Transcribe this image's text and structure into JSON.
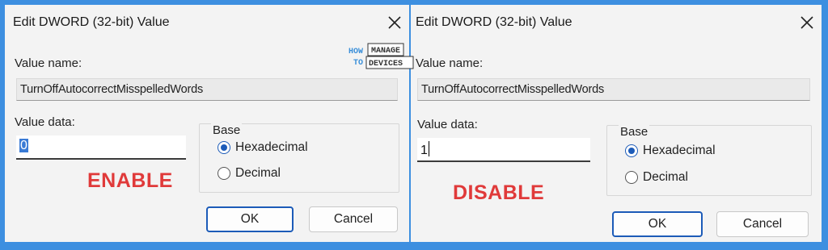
{
  "dialog_left": {
    "title": "Edit DWORD (32-bit) Value",
    "value_name_label": "Value name:",
    "value_name": "TurnOffAutocorrectMisspelledWords",
    "value_data_label": "Value data:",
    "value_data": "0",
    "base_label": "Base",
    "hex_label": "Hexadecimal",
    "dec_label": "Decimal",
    "selected_base": "Hexadecimal",
    "ok_label": "OK",
    "cancel_label": "Cancel",
    "status": "ENABLE"
  },
  "dialog_right": {
    "title": "Edit DWORD (32-bit) Value",
    "value_name_label": "Value name:",
    "value_name": "TurnOffAutocorrectMisspelledWords",
    "value_data_label": "Value data:",
    "value_data": "1",
    "base_label": "Base",
    "hex_label": "Hexadecimal",
    "dec_label": "Decimal",
    "selected_base": "Hexadecimal",
    "ok_label": "OK",
    "cancel_label": "Cancel",
    "status": "DISABLE"
  },
  "logo": {
    "how": "HOW",
    "to": "TO",
    "manage": "MANAGE",
    "devices": "DEVICES"
  },
  "colors": {
    "background": "#3d8fe0",
    "dialog": "#f3f3f3",
    "status_red": "#e03a3a",
    "accent": "#1c5bb8"
  }
}
